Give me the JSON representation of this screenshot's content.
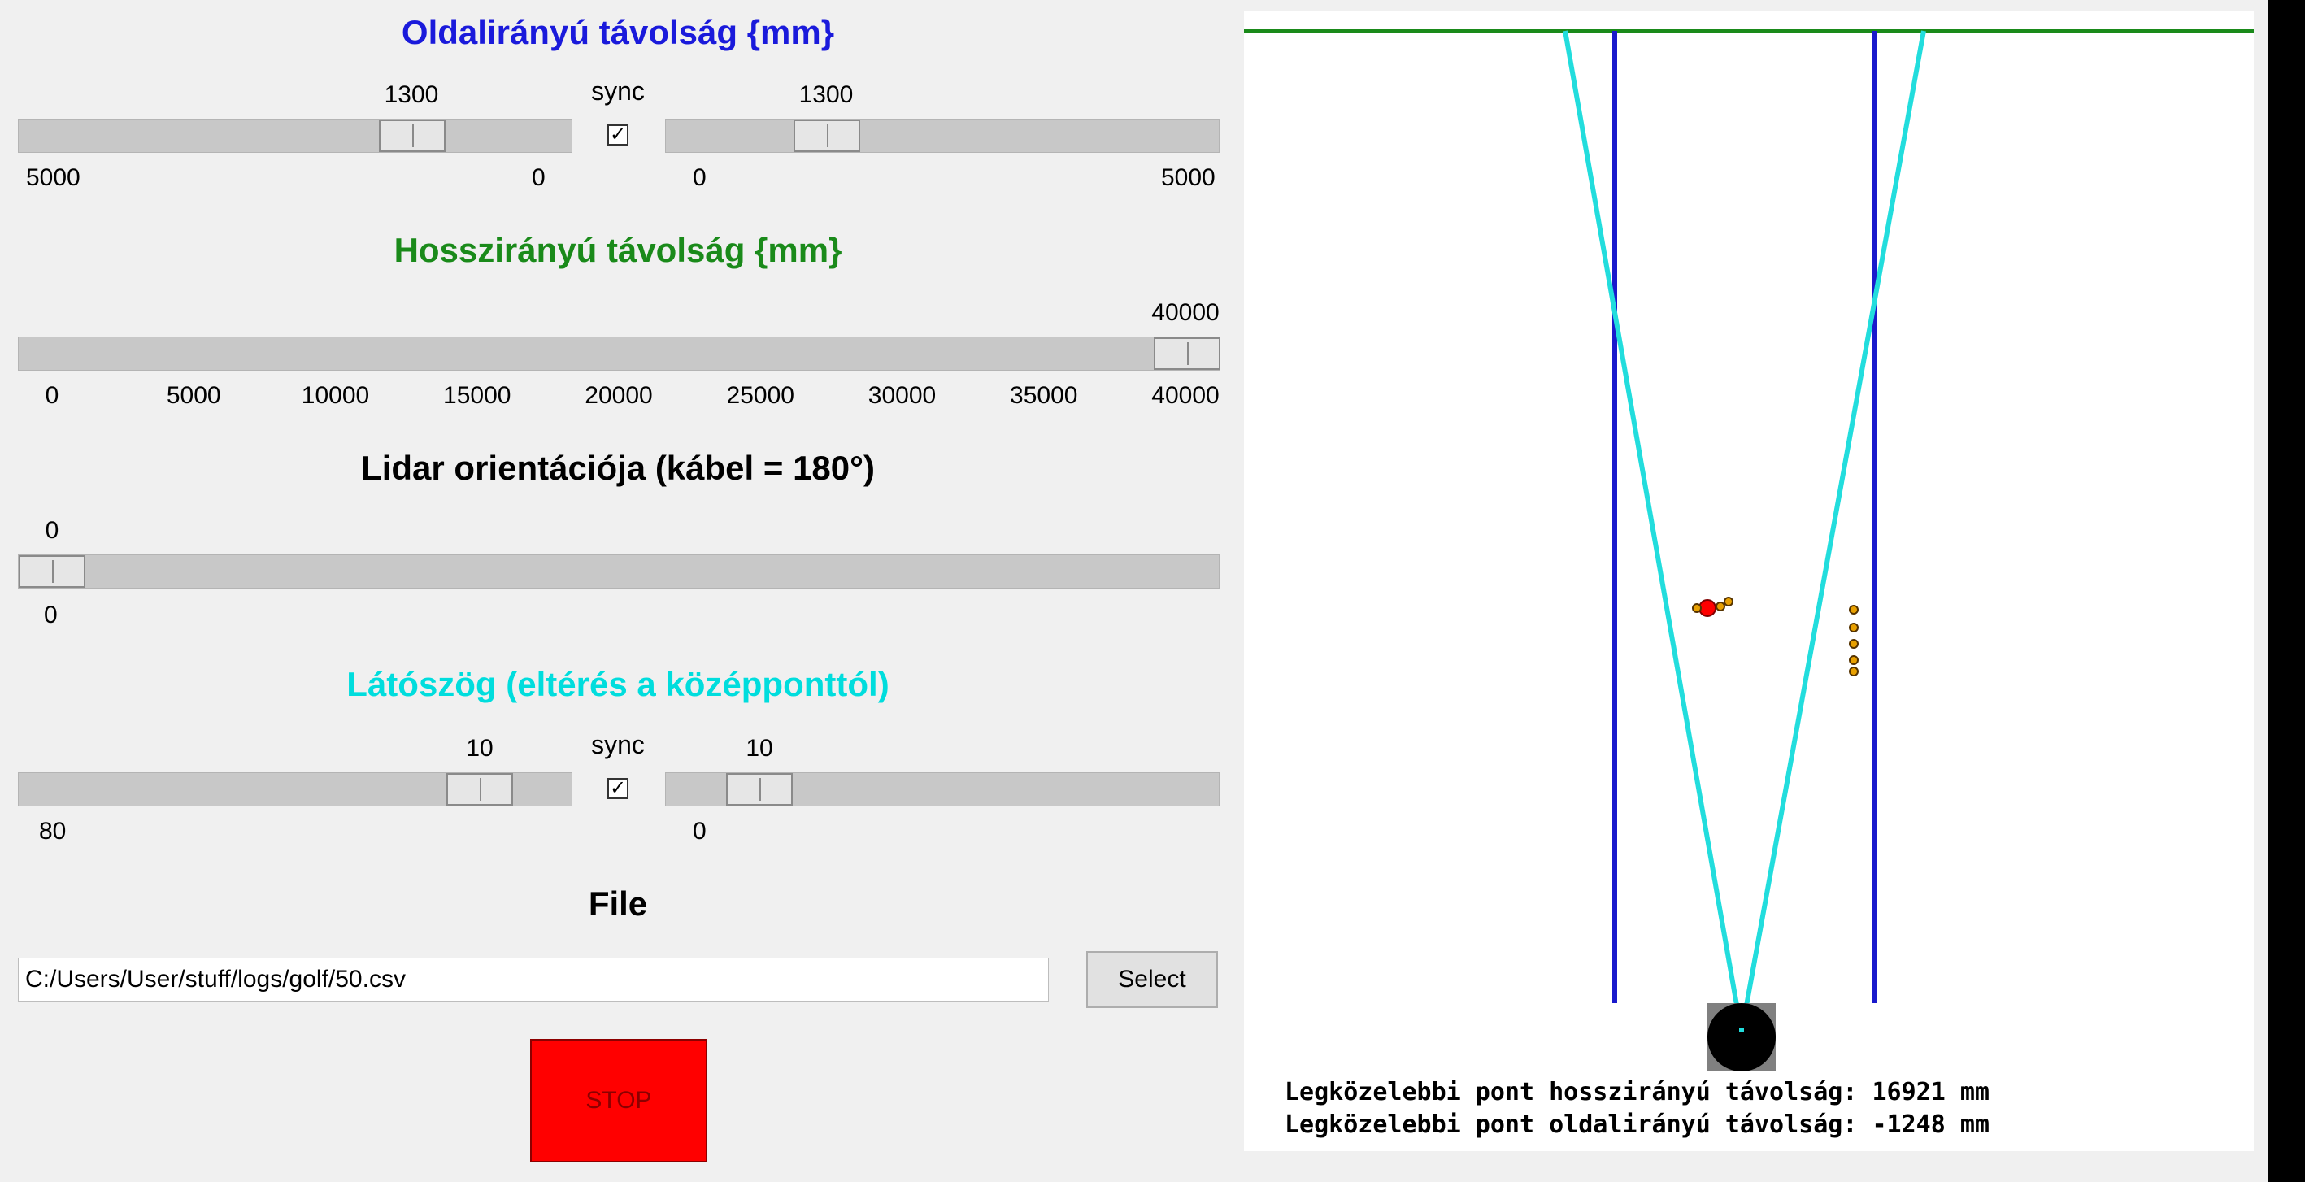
{
  "colors": {
    "lateral_heading": "#1a1adb",
    "longitudinal_heading": "#1a8a1a",
    "fov_heading": "#00dddd",
    "horizon_line": "#1a8a1a",
    "lane_lines": "#1a1acc",
    "fov_lines": "#22dddd",
    "stop_button": "#ff0000",
    "red_point": "#ff0000",
    "orange_point": "#e8a000"
  },
  "lateral": {
    "title": "Oldalirányú távolság {mm}",
    "sync_label": "sync",
    "sync_checked": true,
    "left_slider": {
      "value": 1300,
      "value_text": "1300",
      "min_text": "5000",
      "max_text": "0",
      "min": 5000,
      "max": 0
    },
    "right_slider": {
      "value": 1300,
      "value_text": "1300",
      "min_text": "0",
      "max_text": "5000",
      "min": 0,
      "max": 5000
    }
  },
  "longitudinal": {
    "title": "Hosszirányú távolság {mm}",
    "slider": {
      "value": 40000,
      "value_text": "40000",
      "min": 0,
      "max": 40000
    },
    "ticks": [
      "0",
      "5000",
      "10000",
      "15000",
      "20000",
      "25000",
      "30000",
      "35000",
      "40000"
    ]
  },
  "orientation": {
    "title": "Lidar orientációja (kábel = 180°)",
    "slider": {
      "value": 0,
      "value_text": "0",
      "min_text": "0",
      "min": 0,
      "max": 360
    }
  },
  "fov": {
    "title": "Látószög (eltérés a középponttól)",
    "sync_label": "sync",
    "sync_checked": true,
    "left_slider": {
      "value": 10,
      "value_text": "10",
      "min_text": "80",
      "min": 80,
      "max": 0
    },
    "right_slider": {
      "value": 10,
      "value_text": "10",
      "min_text": "0",
      "min": 0,
      "max": 80
    }
  },
  "file": {
    "title": "File",
    "path": "C:/Users/User/stuff/logs/golf/50.csv",
    "select_label": "Select"
  },
  "stop_label": "STOP",
  "readout": {
    "longitudinal": "Legközelebbi pont hosszirányú távolság: 16921 mm",
    "lateral": "Legközelebbi pont oldalirányú távolság: -1248 mm"
  },
  "checkmark": "✓"
}
